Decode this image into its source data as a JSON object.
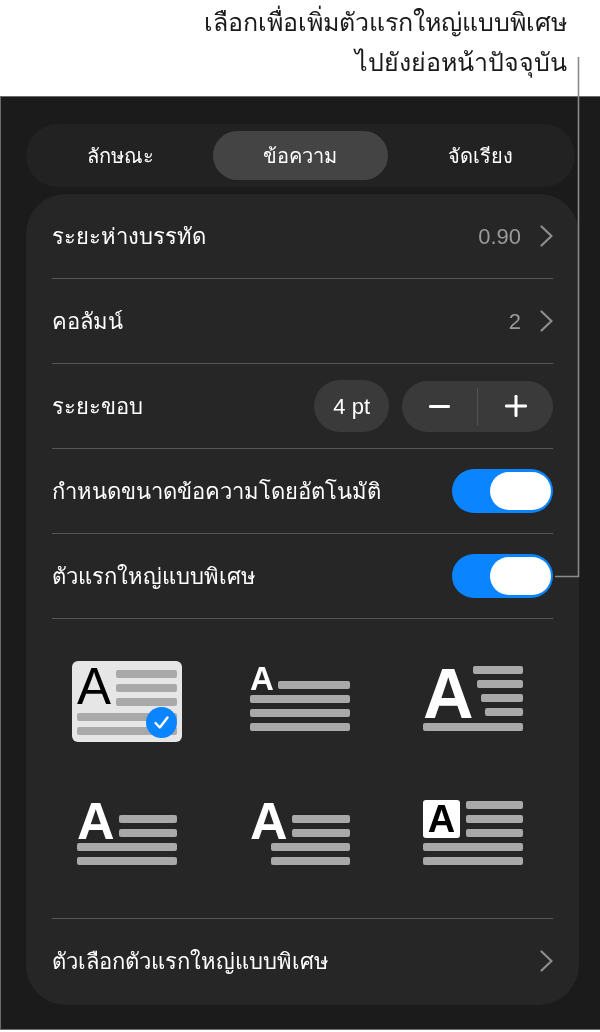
{
  "callout": {
    "lines": [
      "เลือกเพื่อเพิ่มตัวแรกใหญ่แบบพิเศษ",
      "ไปยังย่อหน้าปัจจุบัน"
    ]
  },
  "tabs": [
    {
      "label": "ลักษณะ",
      "selected": false
    },
    {
      "label": "ข้อความ",
      "selected": true
    },
    {
      "label": "จัดเรียง",
      "selected": false
    }
  ],
  "rows": [
    {
      "kind": "value",
      "label": "ระยะห่างบรรทัด",
      "value": "0.90"
    },
    {
      "kind": "value",
      "label": "คอลัมน์",
      "value": "2"
    },
    {
      "kind": "stepper",
      "label": "ระยะขอบ",
      "value": "4 pt"
    },
    {
      "kind": "toggle",
      "label": "กำหนดขนาดข้อความโดยอัตโนมัติ",
      "on": true
    },
    {
      "kind": "toggle",
      "label": "ตัวแรกใหญ่แบบพิเศษ",
      "on": true
    }
  ],
  "drop_cap_styles": [
    {
      "kind": "inline",
      "letter": "A",
      "selected": true
    },
    {
      "kind": "raised",
      "letter": "A",
      "selected": false
    },
    {
      "kind": "large",
      "letter": "A",
      "selected": false
    },
    {
      "kind": "dropped",
      "letter": "A",
      "selected": false
    },
    {
      "kind": "hanging",
      "letter": "A",
      "selected": false
    },
    {
      "kind": "boxed",
      "letter": "A",
      "selected": false
    }
  ],
  "options_row": {
    "label": "ตัวเลือกตัวแรกใหญ่แบบพิเศษ"
  }
}
